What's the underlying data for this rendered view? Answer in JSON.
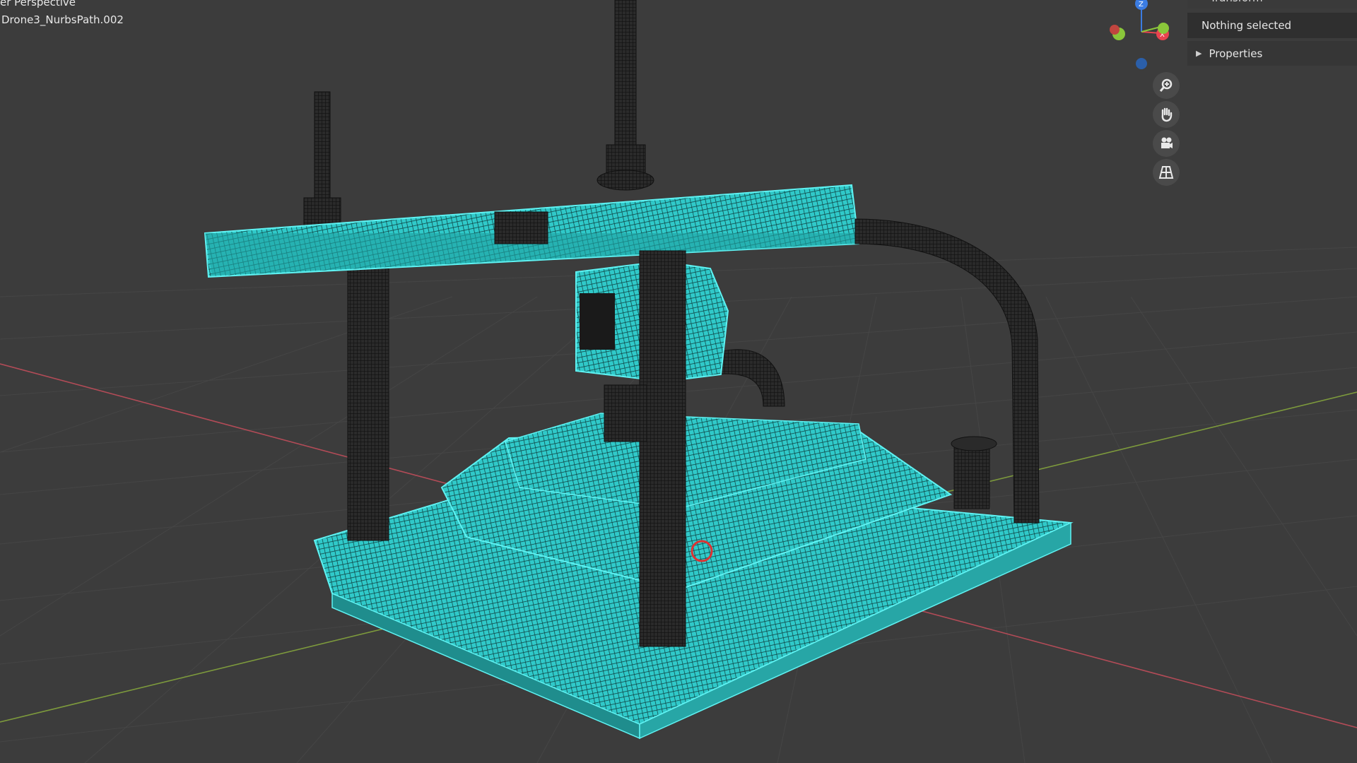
{
  "viewport": {
    "view_label": "er Perspective",
    "object_label": "Drone3_NurbsPath.002"
  },
  "gizmo": {
    "z_label": "Z",
    "x_label": "X",
    "colors": {
      "x": "#e8434f",
      "y": "#8ac63a",
      "z": "#3b7ce2",
      "neg_z": "#2b5fa9"
    }
  },
  "nav_tools": [
    "zoom-icon",
    "hand-pan-icon",
    "camera-icon",
    "grid-perspective-icon"
  ],
  "sidebar": {
    "tab_title": "Transform",
    "status": "Nothing selected",
    "properties_label": "Properties"
  },
  "colors": {
    "background": "#3c3c3c",
    "wire_selected": "#38e6e6",
    "wire_dark": "#1b1b1b",
    "axis_x": "#b24b57",
    "axis_y": "#7d9a3c"
  }
}
